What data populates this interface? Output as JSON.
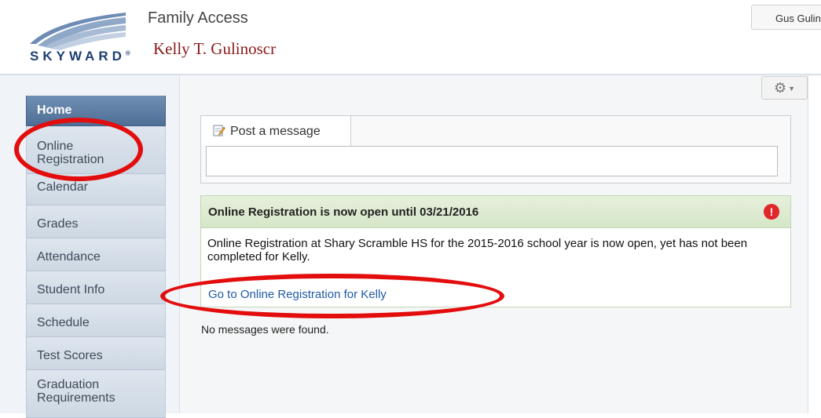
{
  "header": {
    "logo_text": "SKYWARD",
    "app_title": "Family Access",
    "student_name": "Kelly T. Gulinoscr",
    "user_button": "Gus Gulinoscr"
  },
  "sidebar": {
    "items": [
      {
        "label": "Home",
        "active": true
      },
      {
        "label": "Online Registration"
      },
      {
        "label": "Calendar"
      },
      {
        "label": "Grades"
      },
      {
        "label": "Attendance"
      },
      {
        "label": "Student Info"
      },
      {
        "label": "Schedule"
      },
      {
        "label": "Test Scores"
      },
      {
        "label": "Graduation Requirements"
      }
    ]
  },
  "toolbar": {
    "settings_icon": "gear-icon"
  },
  "post": {
    "tab_label": "Post a message",
    "icon": "pencil-note-icon"
  },
  "notice": {
    "title": "Online Registration is now open until 03/21/2016",
    "alert_icon": "exclamation-icon",
    "body": "Online Registration at Shary Scramble HS for the 2015-2016 school year is now open, yet has not been completed for Kelly.",
    "link": "Go to Online Registration for Kelly"
  },
  "messages": {
    "empty_text": "No messages were found."
  },
  "colors": {
    "nav_active": "#5577a0",
    "notice_header": "#dde9d0",
    "link": "#1f5aa3",
    "annotation": "#e30d0d",
    "student_name": "#8b1a1a"
  }
}
